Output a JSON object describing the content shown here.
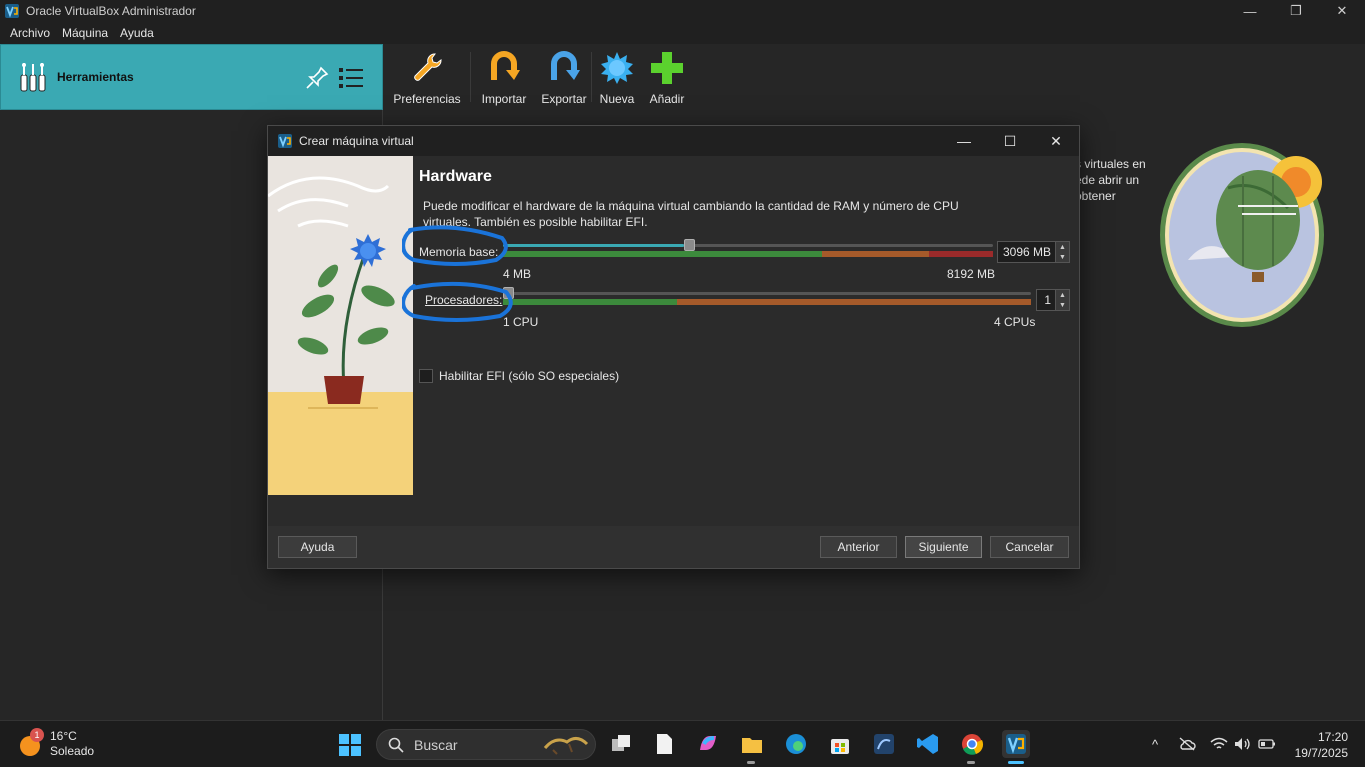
{
  "window": {
    "title": "Oracle VirtualBox Administrador",
    "minimize": "—",
    "maximize": "❐",
    "close": "✕"
  },
  "menu": {
    "items": [
      {
        "label": "Archivo"
      },
      {
        "label": "Máquina"
      },
      {
        "label": "Ayuda"
      }
    ]
  },
  "tools": {
    "label": "Herramientas"
  },
  "toolbar": {
    "buttons": [
      {
        "label": "Preferencias",
        "icon": "wrench-icon"
      },
      {
        "label": "Importar",
        "icon": "import-arrow-icon"
      },
      {
        "label": "Exportar",
        "icon": "export-arrow-icon"
      },
      {
        "label": "Nueva",
        "icon": "new-star-icon"
      },
      {
        "label": "Añadir",
        "icon": "add-plus-icon"
      }
    ]
  },
  "welcome": {
    "line1": "s virtuales en",
    "line2": "ede abrir un",
    "line3": "obtener"
  },
  "dialog": {
    "title": "Crear máquina virtual",
    "heading": "Hardware",
    "description": "Puede modificar el hardware de la máquina virtual cambiando la cantidad de RAM y número de CPU virtuales. También es posible habilitar EFI.",
    "memory": {
      "label": "Memoria base:",
      "value": "3096 MB",
      "min_label": "4 MB",
      "max_label": "8192 MB",
      "min": 4,
      "max": 8192,
      "current": 3096
    },
    "processors": {
      "label": "Procesadores:",
      "value": "1",
      "min_label": "1 CPU",
      "max_label": "4 CPUs",
      "min": 1,
      "max": 4,
      "current": 1
    },
    "efi_label": "Habilitar EFI (sólo SO especiales)",
    "efi_checked": false,
    "buttons": {
      "help": "Ayuda",
      "back": "Anterior",
      "next": "Siguiente",
      "cancel": "Cancelar"
    }
  },
  "taskbar": {
    "weather_temp": "16°C",
    "weather_desc": "Soleado",
    "weather_badge": "1",
    "search_placeholder": "Buscar",
    "time": "17:20",
    "date": "19/7/2025"
  },
  "colors": {
    "accent": "#3aa9b3",
    "annotation": "#1a73d9",
    "bar_green": "#3c8a3c",
    "bar_orange": "#a55a2a",
    "bar_red": "#9a2a2a"
  }
}
